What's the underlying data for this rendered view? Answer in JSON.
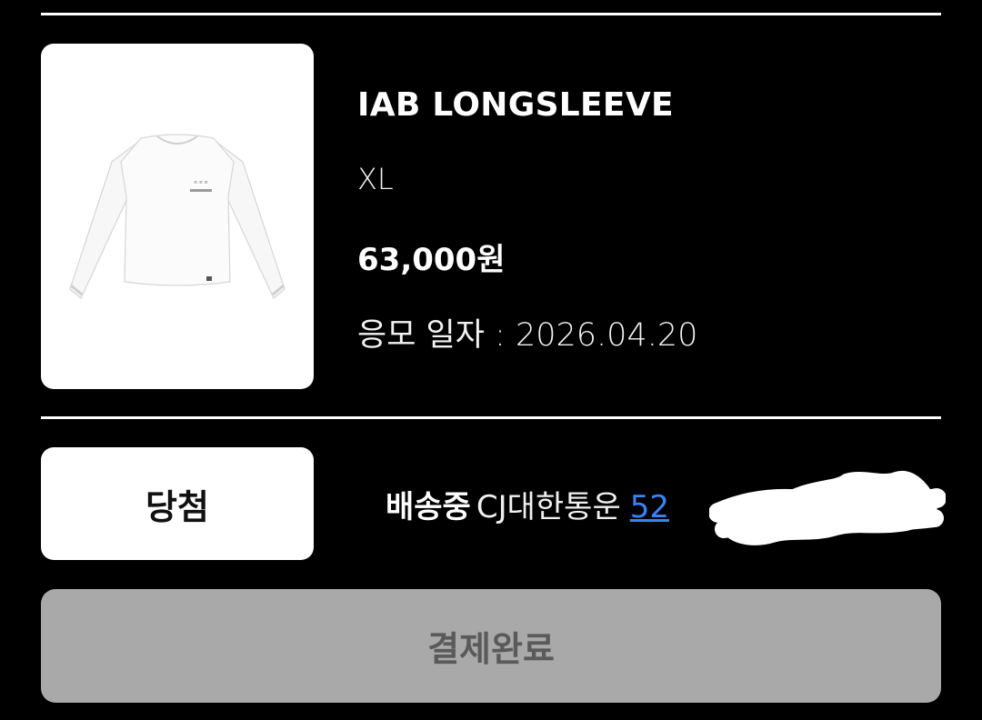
{
  "product": {
    "name": "IAB LONGSLEEVE",
    "size": "XL",
    "price": "63,000원",
    "date_label": "응모 일자",
    "date_separator": " : ",
    "date_value": "2026.04.20"
  },
  "result": {
    "status_label": "당첨"
  },
  "shipping": {
    "status": "배송중",
    "carrier": "CJ대한통운",
    "tracking_visible": "52"
  },
  "payment": {
    "button_label": "결제완료"
  },
  "colors": {
    "background": "#000000",
    "card": "#ffffff",
    "link": "#3b82f6",
    "disabled_button": "#a9a9a9",
    "disabled_text": "#5a5a5a"
  }
}
